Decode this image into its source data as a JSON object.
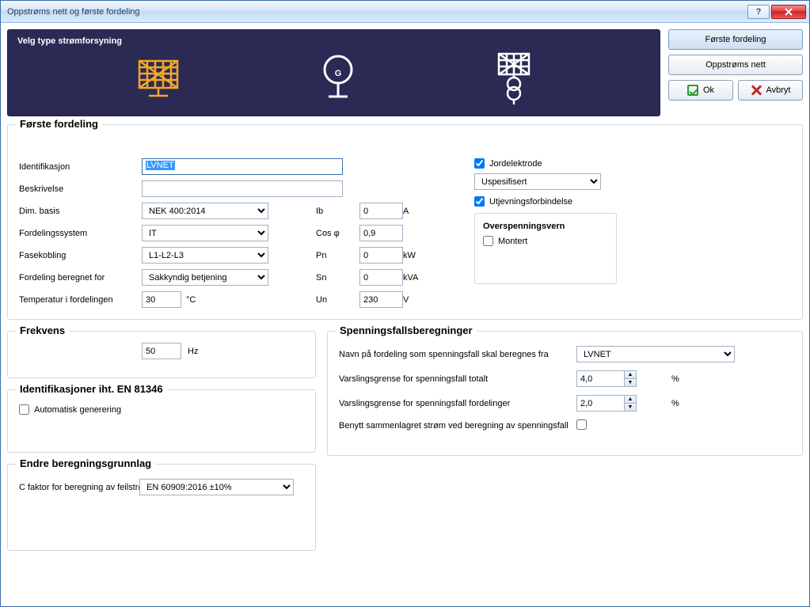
{
  "window": {
    "title": "Oppstrøms nett og første fordeling"
  },
  "supply": {
    "title": "Velg type strømforsyning"
  },
  "side": {
    "first": "Første fordeling",
    "upstream": "Oppstrøms nett",
    "ok": "Ok",
    "cancel": "Avbryt"
  },
  "first_dist": {
    "title": "Første fordeling",
    "id_label": "Identifikasjon",
    "id_value": "LVNET",
    "desc_label": "Beskrivelse",
    "desc_value": "",
    "dimbasis_label": "Dim. basis",
    "dimbasis_value": "NEK 400:2014",
    "system_label": "Fordelingssystem",
    "system_value": "IT",
    "phase_label": "Fasekobling",
    "phase_value": "L1-L2-L3",
    "intended_label": "Fordeling beregnet for",
    "intended_value": "Sakkyndig betjening",
    "temp_label": "Temperatur i fordelingen",
    "temp_value": "30",
    "temp_unit": "°C",
    "ib_label": "Ib",
    "ib_value": "0",
    "ib_unit": "A",
    "cos_label": "Cos  φ",
    "cos_value": "0,9",
    "pn_label": "Pn",
    "pn_value": "0",
    "pn_unit": "kW",
    "sn_label": "Sn",
    "sn_value": "0",
    "sn_unit": "kVA",
    "un_label": "Un",
    "un_value": "230",
    "un_unit": "V",
    "earth_label": "Jordelektrode",
    "earth_type_value": "Uspesifisert",
    "bonding_label": "Utjevningsforbindelse",
    "surge_title": "Overspenningsvern",
    "surge_installed_label": "Montert"
  },
  "freq": {
    "title": "Frekvens",
    "value": "50",
    "unit": "Hz"
  },
  "volt": {
    "title": "Spenningsfallsberegninger",
    "from_label": "Navn på fordeling som spenningsfall skal beregnes fra",
    "from_value": "LVNET",
    "total_label": "Varslingsgrense for spenningsfall totalt",
    "total_value": "4,0",
    "dist_label": "Varslingsgrense for spenningsfall fordelinger",
    "dist_value": "2,0",
    "coincident_label": "Benytt sammenlagret strøm ved beregning av spenningsfall",
    "pct": "%"
  },
  "ident": {
    "title": "Identifikasjoner iht. EN 81346",
    "auto_label": "Automatisk generering"
  },
  "calc": {
    "title": "Endre beregningsgrunnlag",
    "cfactor_label": "C faktor for beregning av feilstrømmer",
    "cfactor_value": "EN 60909:2016 ±10%"
  }
}
